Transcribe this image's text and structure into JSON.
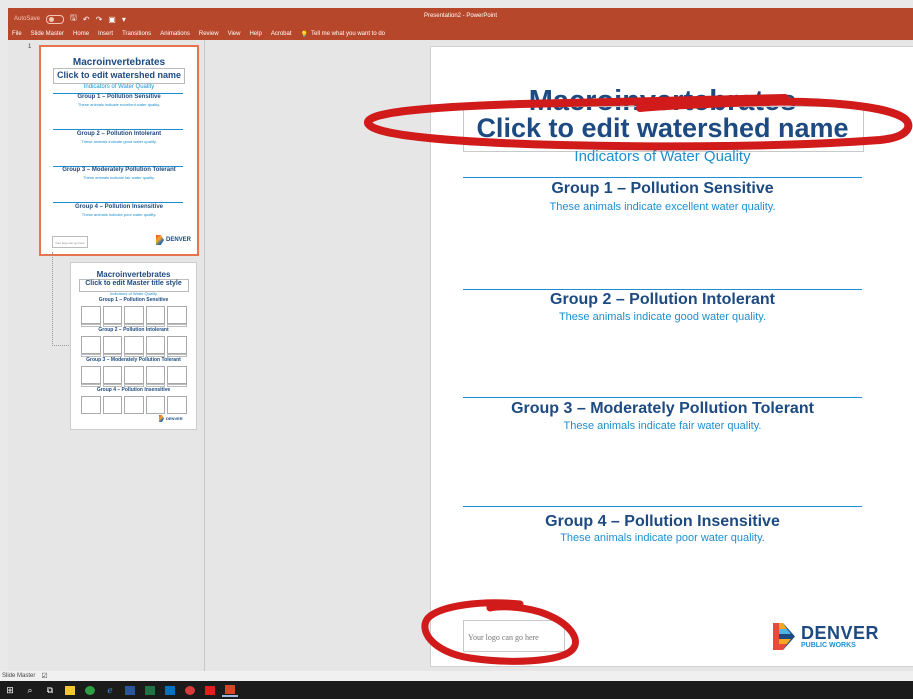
{
  "titlebar": {
    "autosave_label": "AutoSave",
    "toggle_state": "Off",
    "document_title": "Presentation2 - PowerPoint"
  },
  "ribbon": {
    "tabs": [
      "File",
      "Slide Master",
      "Home",
      "Insert",
      "Transitions",
      "Animations",
      "Review",
      "View",
      "Help",
      "Acrobat"
    ],
    "tell_me": "Tell me what you want to do"
  },
  "thumbnails": {
    "number": "1",
    "master": {
      "title": "Macroinvertebrates",
      "subtitle_title": "Click to edit watershed name",
      "subtitle": "Indicators of Water Quality",
      "groups": [
        {
          "heading": "Group 1 – Pollution Sensitive",
          "desc": "These animals indicate excellent water quality."
        },
        {
          "heading": "Group 2 – Pollution Intolerant",
          "desc": "These animals indicate good water quality."
        },
        {
          "heading": "Group 3 – Moderately Pollution Tolerant",
          "desc": "These animals indicate fair water quality."
        },
        {
          "heading": "Group 4 – Pollution Insensitive",
          "desc": "These animals indicate poor water quality."
        }
      ],
      "logo_placeholder": "Your logo can go here",
      "brand": "DENVER",
      "brand_sub": "PUBLIC WORKS"
    },
    "layout": {
      "title": "Macroinvertebrates",
      "subtitle_title": "Click to edit Master title style",
      "subtitle": "Indicators of Water Quality",
      "groups": [
        "Group 1 – Pollution Sensitive",
        "Group 2 – Pollution Intolerant",
        "Group 3 – Moderately Pollution Tolerant",
        "Group 4 – Pollution Insensitive"
      ],
      "brand": "DENVER"
    }
  },
  "slide": {
    "title": "Macroinvertebrates",
    "watershed_placeholder": "Click to edit watershed name",
    "subtitle": "Indicators of Water Quality",
    "groups": [
      {
        "heading": "Group 1 – Pollution Sensitive",
        "desc": "These animals indicate excellent water quality."
      },
      {
        "heading": "Group 2 – Pollution Intolerant",
        "desc": "These animals indicate good water quality."
      },
      {
        "heading": "Group 3 – Moderately Pollution Tolerant",
        "desc": "These animals indicate fair water quality."
      },
      {
        "heading": "Group 4 – Pollution Insensitive",
        "desc": "These animals indicate poor water quality."
      }
    ],
    "logo_placeholder": "Your logo can go here",
    "brand": "DENVER",
    "brand_sub": "PUBLIC WORKS"
  },
  "status": {
    "view_label": "Slide Master"
  },
  "colors": {
    "ribbon": "#b7472a",
    "title_blue": "#1d4a80",
    "accent_blue": "#1c8fd0",
    "annotation_red": "#d11a1a",
    "thumb_selected": "#e8734f"
  },
  "taskbar_icons": [
    "windows-start-icon",
    "search-icon",
    "task-view-icon",
    "file-explorer-icon",
    "chrome-icon",
    "edge-icon",
    "word-icon",
    "excel-icon",
    "outlook-icon",
    "app-icon",
    "acrobat-icon",
    "powerpoint-icon"
  ]
}
